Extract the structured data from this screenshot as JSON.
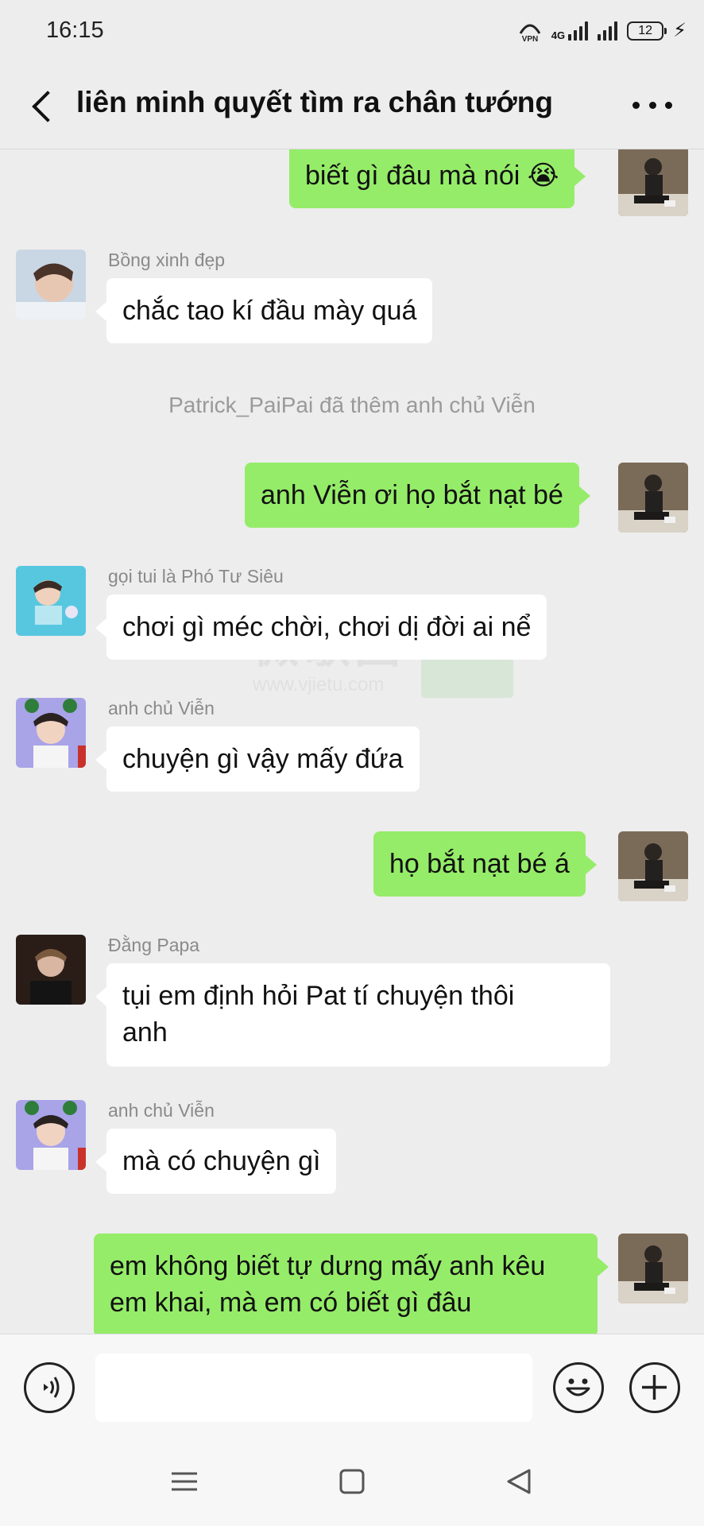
{
  "status_bar": {
    "time": "16:15",
    "vpn": "VPN",
    "network": "4G",
    "battery": "12"
  },
  "header": {
    "title": "liên minh quyết tìm ra chân tướng"
  },
  "messages": [
    {
      "text": "biết gì đâu mà nói 😭"
    },
    {
      "sender": "Bồng xinh đẹp",
      "text": "chắc tao kí đầu mày quá"
    },
    {
      "system": "Patrick_PaiPai đã thêm anh chủ Viễn"
    },
    {
      "text": "anh Viễn ơi họ bắt nạt bé"
    },
    {
      "sender": "gọi tui là Phó Tư Siêu",
      "text": "chơi gì méc chời, chơi dị đời ai nể"
    },
    {
      "sender": "anh chủ Viễn",
      "text": "chuyện gì vậy mấy đứa"
    },
    {
      "text": "họ bắt nạt bé á"
    },
    {
      "sender": "Đằng Papa",
      "line1": "tụi em định hỏi Pat tí chuyện thôi",
      "line2": "anh"
    },
    {
      "sender": "anh chủ Viễn",
      "text": "mà có chuyện gì"
    },
    {
      "line1": "em không biết tự dưng mấy anh kêu",
      "line2": "em khai, mà em có biết gì đâu"
    }
  ],
  "watermark": {
    "text": "微歌图",
    "url": "www.vjietu.com"
  },
  "input": {
    "placeholder": ""
  },
  "colors": {
    "self_bubble": "#95ec69",
    "other_bubble": "#ffffff",
    "background": "#ededed"
  },
  "icons": [
    "back-arrow-icon",
    "more-icon",
    "voice-icon",
    "emoji-icon",
    "plus-icon",
    "menu-icon",
    "home-icon",
    "back-triangle-icon"
  ]
}
